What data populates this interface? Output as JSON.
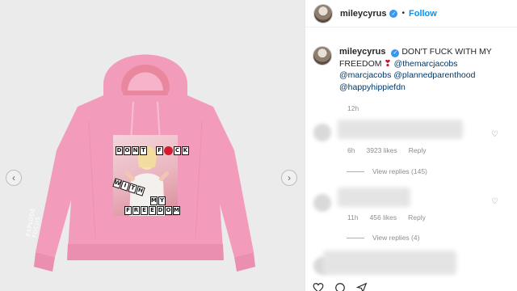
{
  "post": {
    "username": "mileycyrus",
    "follow_label": "Follow",
    "separator": "•",
    "verified_glyph": "✓"
  },
  "caption": {
    "username": "mileycyrus",
    "text": "DON'T FUCK WITH MY FREEDOM",
    "heart": "❣",
    "mentions": [
      "@themarcjacobs",
      "@marcjacobs",
      "@plannedparenthood",
      "@happyhippiefdn"
    ],
    "time": "12h"
  },
  "print_tiles": {
    "row1": [
      "D",
      "O",
      "N",
      "T",
      " ",
      "F",
      "",
      "C",
      "K"
    ],
    "row2": [
      "W",
      "I",
      "T",
      "H"
    ],
    "row3": [
      "M",
      "Y"
    ],
    "row4": [
      "F",
      "R",
      "E",
      "E",
      "D",
      "O",
      "M"
    ]
  },
  "sleeve_text": [
    "EXPLODE",
    "FOCUS"
  ],
  "comments": [
    {
      "time": "6h",
      "likes": "3923 likes",
      "reply": "Reply",
      "view_replies": "View replies (145)"
    },
    {
      "time": "11h",
      "likes": "456 likes",
      "reply": "Reply",
      "view_replies": "View replies (4)"
    }
  ],
  "icons": {
    "prev": "chevron-left-icon",
    "next": "chevron-right-icon",
    "like": "heart-outline-icon",
    "comment": "comment-icon",
    "share": "share-icon"
  },
  "colors": {
    "hoodie": "#f29bbb",
    "follow_blue": "#0095f6",
    "verified_blue": "#3897f0",
    "heart_red": "#d6192d"
  }
}
